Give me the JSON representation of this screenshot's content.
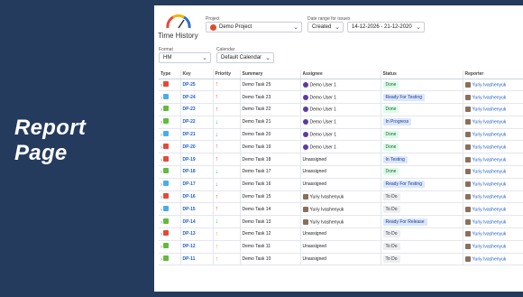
{
  "hero": {
    "title": "Report Page"
  },
  "app": {
    "logo_text": "Time History"
  },
  "filters": {
    "project_label": "Project",
    "project_value": "Demo Project",
    "date_range_label": "Date range for issues",
    "date_field": "Created",
    "date_range": "14-12-2026 - 21-12-2020",
    "format_label": "Format",
    "format_value": "HM",
    "calendar_label": "Calendar",
    "calendar_value": "Default Calendar"
  },
  "colors": {
    "background": "#243b5e",
    "type_bug": "#e5493a",
    "type_task": "#4bade8",
    "type_story": "#63ba3c",
    "priority_high": "#e5493a",
    "priority_medium": "#f79232",
    "priority_low": "#36b37e",
    "status_done": "#dcfce7",
    "status_ready": "#dbe7ff",
    "status_todo": "#eceef1"
  },
  "table": {
    "headers": [
      "Type",
      "Key",
      "Priority",
      "Summary",
      "Assignee",
      "Status",
      "Reporter"
    ],
    "rows": [
      {
        "type": "bug",
        "key": "DP-25",
        "priority": "high",
        "summary": "Demo Task 25",
        "assignee": "Demo User 1",
        "status": "Done",
        "reporter": "Yuriy Ivashenyuk"
      },
      {
        "type": "task",
        "key": "DP-24",
        "priority": "high",
        "summary": "Demo Task 23",
        "assignee": "Demo User 1",
        "status": "Ready For Testing",
        "reporter": "Yuriy Ivashenyuk"
      },
      {
        "type": "story",
        "key": "DP-23",
        "priority": "high",
        "summary": "Demo Task 22",
        "assignee": "Demo User 1",
        "status": "Done",
        "reporter": "Yuriy Ivashenyuk"
      },
      {
        "type": "story",
        "key": "DP-22",
        "priority": "low",
        "summary": "Demo Task 21",
        "assignee": "Demo User 1",
        "status": "In Progress",
        "reporter": "Yuriy Ivashenyuk"
      },
      {
        "type": "task",
        "key": "DP-21",
        "priority": "low",
        "summary": "Demo Task 20",
        "assignee": "Demo User 1",
        "status": "Done",
        "reporter": "Yuriy Ivashenyuk"
      },
      {
        "type": "bug",
        "key": "DP-20",
        "priority": "high",
        "summary": "Demo Task 19",
        "assignee": "Demo User 1",
        "status": "Done",
        "reporter": "Yuriy Ivashenyuk"
      },
      {
        "type": "bug",
        "key": "DP-19",
        "priority": "high",
        "summary": "Demo Task 18",
        "assignee": "Unassigned",
        "status": "In Testing",
        "reporter": "Yuriy Ivashenyuk"
      },
      {
        "type": "story",
        "key": "DP-18",
        "priority": "low",
        "summary": "Demo Task 17",
        "assignee": "Unassigned",
        "status": "Done",
        "reporter": "Yuriy Ivashenyuk"
      },
      {
        "type": "task",
        "key": "DP-17",
        "priority": "low",
        "summary": "Demo Task 16",
        "assignee": "Unassigned",
        "status": "Ready For Testing",
        "reporter": "Yuriy Ivashenyuk"
      },
      {
        "type": "bug",
        "key": "DP-16",
        "priority": "high",
        "summary": "Demo Task 15",
        "assignee": "Yuriy Ivashenyuk",
        "status": "To Do",
        "reporter": "Yuriy Ivashenyuk"
      },
      {
        "type": "task",
        "key": "DP-15",
        "priority": "high",
        "summary": "Demo Task 14",
        "assignee": "Yuriy Ivashenyuk",
        "status": "To Do",
        "reporter": "Yuriy Ivashenyuk"
      },
      {
        "type": "story",
        "key": "DP-14",
        "priority": "low",
        "summary": "Demo Task 13",
        "assignee": "Yuriy Ivashenyuk",
        "status": "Ready For Release",
        "reporter": "Yuriy Ivashenyuk"
      },
      {
        "type": "bug",
        "key": "DP-13",
        "priority": "medium",
        "summary": "Demo Task 12",
        "assignee": "Unassigned",
        "status": "To Do",
        "reporter": "Yuriy Ivashenyuk"
      },
      {
        "type": "story",
        "key": "DP-12",
        "priority": "medium",
        "summary": "Demo Task 11",
        "assignee": "Unassigned",
        "status": "To Do",
        "reporter": "Yuriy Ivashenyuk"
      },
      {
        "type": "story",
        "key": "DP-11",
        "priority": "medium",
        "summary": "Demo Task 10",
        "assignee": "Unassigned",
        "status": "To Do",
        "reporter": "Yuriy Ivashenyuk"
      }
    ]
  }
}
